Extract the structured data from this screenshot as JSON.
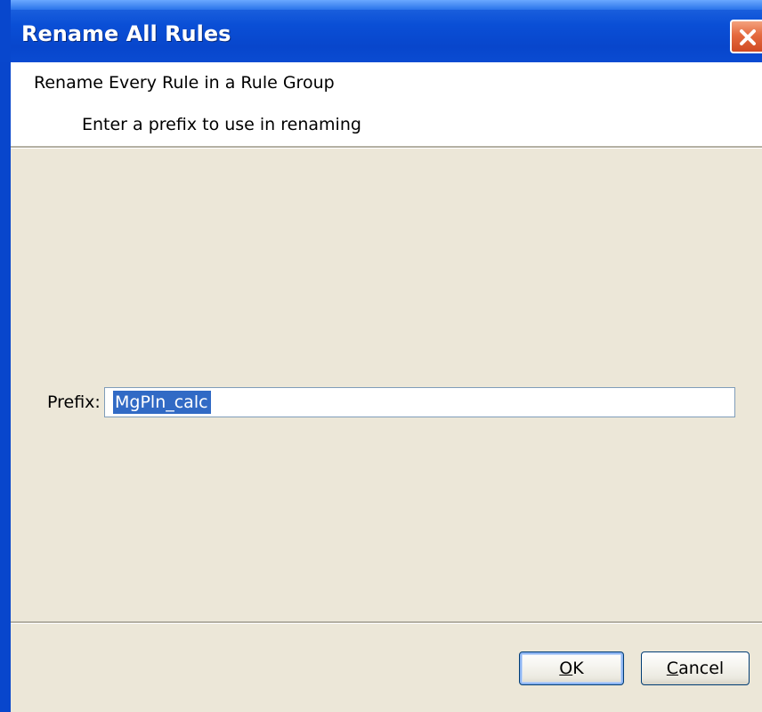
{
  "window": {
    "title": "Rename All Rules"
  },
  "header": {
    "title": "Rename Every Rule in a Rule Group",
    "subtitle": "Enter a prefix to use in renaming"
  },
  "form": {
    "prefix_label": "Prefix:",
    "prefix_value": "MgPln_calc",
    "prefix_value_selected": true
  },
  "buttons": {
    "ok_mnemonic": "O",
    "ok_rest": "K",
    "cancel_mnemonic": "C",
    "cancel_rest": "ancel"
  },
  "icons": {
    "close": "close-icon"
  },
  "colors": {
    "titlebar": "#0a4fd6",
    "close_button": "#e56a3f",
    "dialog_body": "#ece7d8",
    "selection": "#316ac5"
  }
}
